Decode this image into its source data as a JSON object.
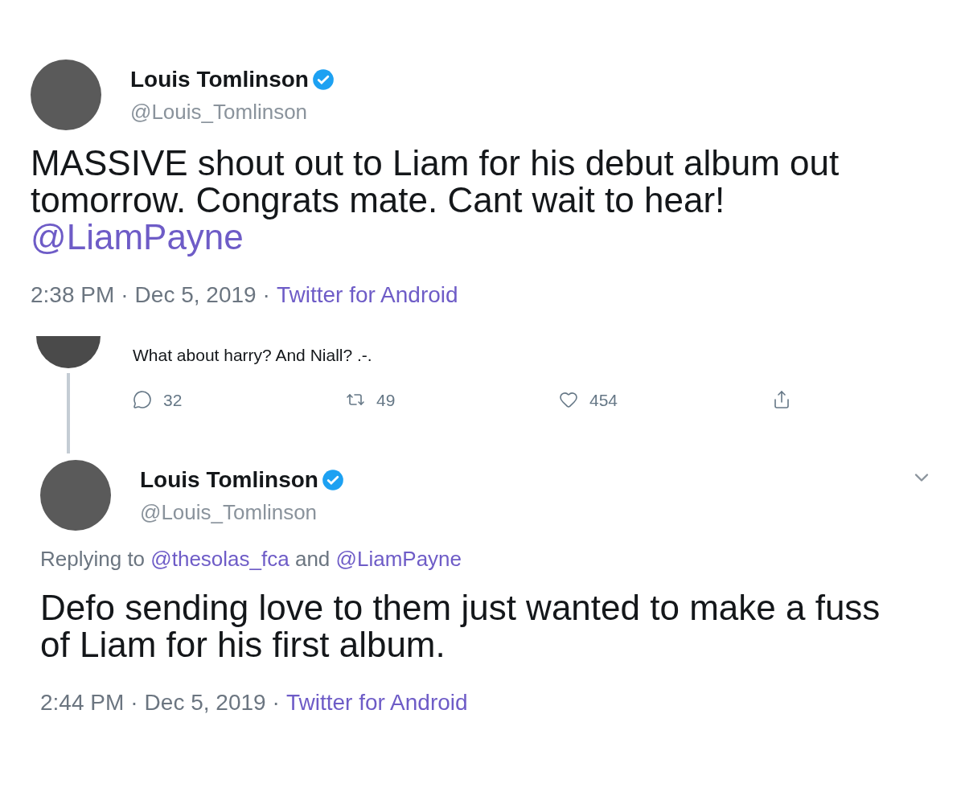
{
  "tweets": [
    {
      "kind": "tweet",
      "author": {
        "name": "Louis Tomlinson",
        "handle": "@Louis_Tomlinson",
        "verified": true
      },
      "menu": false,
      "body": [
        {
          "kind": "text",
          "text": "MASSIVE shout out to Liam for his debut album out tomorrow. Congrats mate. Cant wait to hear!"
        },
        {
          "kind": "mention-line",
          "text": "@LiamPayne"
        }
      ],
      "meta": [
        {
          "kind": "plain",
          "text": "2:38 PM"
        },
        {
          "kind": "separator",
          "text": "·"
        },
        {
          "kind": "plain",
          "text": "Dec 5, 2019"
        },
        {
          "kind": "separator",
          "text": "·"
        },
        {
          "kind": "link",
          "text": "Twitter for Android"
        }
      ]
    },
    {
      "kind": "reply-partial",
      "body": "What about harry? And Niall? .-.",
      "actions": [
        {
          "kind": "reply",
          "count": "32"
        },
        {
          "kind": "retweet",
          "count": "49"
        },
        {
          "kind": "like",
          "count": "454"
        },
        {
          "kind": "share"
        }
      ]
    },
    {
      "kind": "tweet",
      "author": {
        "name": "Louis Tomlinson",
        "handle": "@Louis_Tomlinson",
        "verified": true
      },
      "menu": true,
      "replying": [
        {
          "kind": "plain",
          "text": "Replying to"
        },
        {
          "kind": "mention",
          "text": "@thesolas_fca"
        },
        {
          "kind": "plain",
          "text": "and"
        },
        {
          "kind": "mention",
          "text": "@LiamPayne"
        }
      ],
      "body": [
        {
          "kind": "text",
          "text": "Defo sending love to them just wanted to make a fuss of Liam for his first album."
        }
      ],
      "meta": [
        {
          "kind": "plain",
          "text": "2:44 PM"
        },
        {
          "kind": "separator",
          "text": "·"
        },
        {
          "kind": "plain",
          "text": "Dec 5, 2019"
        },
        {
          "kind": "separator",
          "text": "·"
        },
        {
          "kind": "link",
          "text": "Twitter for Android"
        }
      ]
    }
  ]
}
